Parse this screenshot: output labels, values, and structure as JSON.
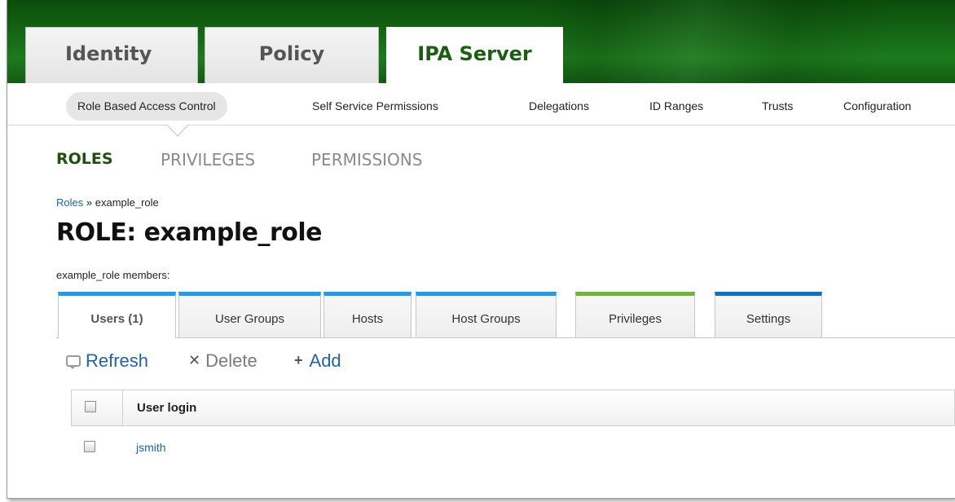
{
  "top_tabs": [
    {
      "label": "Identity",
      "active": false
    },
    {
      "label": "Policy",
      "active": false
    },
    {
      "label": "IPA Server",
      "active": true
    }
  ],
  "subnav": [
    {
      "label": "Role Based Access Control",
      "active": true
    },
    {
      "label": "Self Service Permissions",
      "active": false
    },
    {
      "label": "Delegations",
      "active": false
    },
    {
      "label": "ID Ranges",
      "active": false
    },
    {
      "label": "Trusts",
      "active": false
    },
    {
      "label": "Configuration",
      "active": false
    }
  ],
  "entity_tabs": [
    {
      "label": "ROLES",
      "active": true
    },
    {
      "label": "PRIVILEGES",
      "active": false
    },
    {
      "label": "PERMISSIONS",
      "active": false
    }
  ],
  "breadcrumb": {
    "parent": "Roles",
    "separator": "»",
    "current": "example_role"
  },
  "page_title": "ROLE: example_role",
  "members_label": "example_role members:",
  "facet_tabs": [
    {
      "label": "Users (1)",
      "active": true,
      "color": "#2f97d3"
    },
    {
      "label": "User Groups",
      "active": false,
      "color": "#2f97d3"
    },
    {
      "label": "Hosts",
      "active": false,
      "color": "#2f97d3"
    },
    {
      "label": "Host Groups",
      "active": false,
      "color": "#2f97d3"
    },
    {
      "label": "Privileges",
      "active": false,
      "color": "#6fb249"
    },
    {
      "label": "Settings",
      "active": false,
      "color": "#1c6fab"
    }
  ],
  "actions": {
    "refresh": {
      "label": "Refresh",
      "icon": "refresh-icon",
      "enabled": true
    },
    "delete": {
      "label": "Delete",
      "icon": "x-icon",
      "enabled": false
    },
    "add": {
      "label": "Add",
      "icon": "plus-icon",
      "enabled": true
    }
  },
  "table": {
    "columns": [
      "User login"
    ],
    "rows": [
      {
        "user_login": "jsmith"
      }
    ]
  },
  "colors": {
    "header_green": "#146314",
    "active_tab_text": "#1b5e12",
    "link": "#2263a8",
    "facet_blue": "#2f97d3",
    "facet_green": "#6fb249"
  }
}
